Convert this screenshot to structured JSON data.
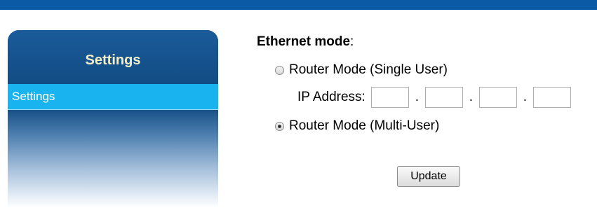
{
  "sidebar": {
    "title": "Settings",
    "items": [
      {
        "label": "Settings"
      }
    ]
  },
  "main": {
    "section_title": "Ethernet mode",
    "section_title_suffix": ":",
    "options": [
      {
        "label": "Router Mode (Single User)",
        "checked": false
      },
      {
        "label": "Router Mode (Multi-User)",
        "checked": true
      }
    ],
    "ip_address": {
      "label": "IP Address:",
      "octets": [
        "",
        "",
        "",
        ""
      ],
      "separator": "."
    },
    "update_label": "Update"
  },
  "colors": {
    "top_bar": "#0b5aa6",
    "sidebar_header": "#124c84",
    "sidebar_title": "#f2eec6",
    "sidebar_item_active": "#19b4f0"
  }
}
